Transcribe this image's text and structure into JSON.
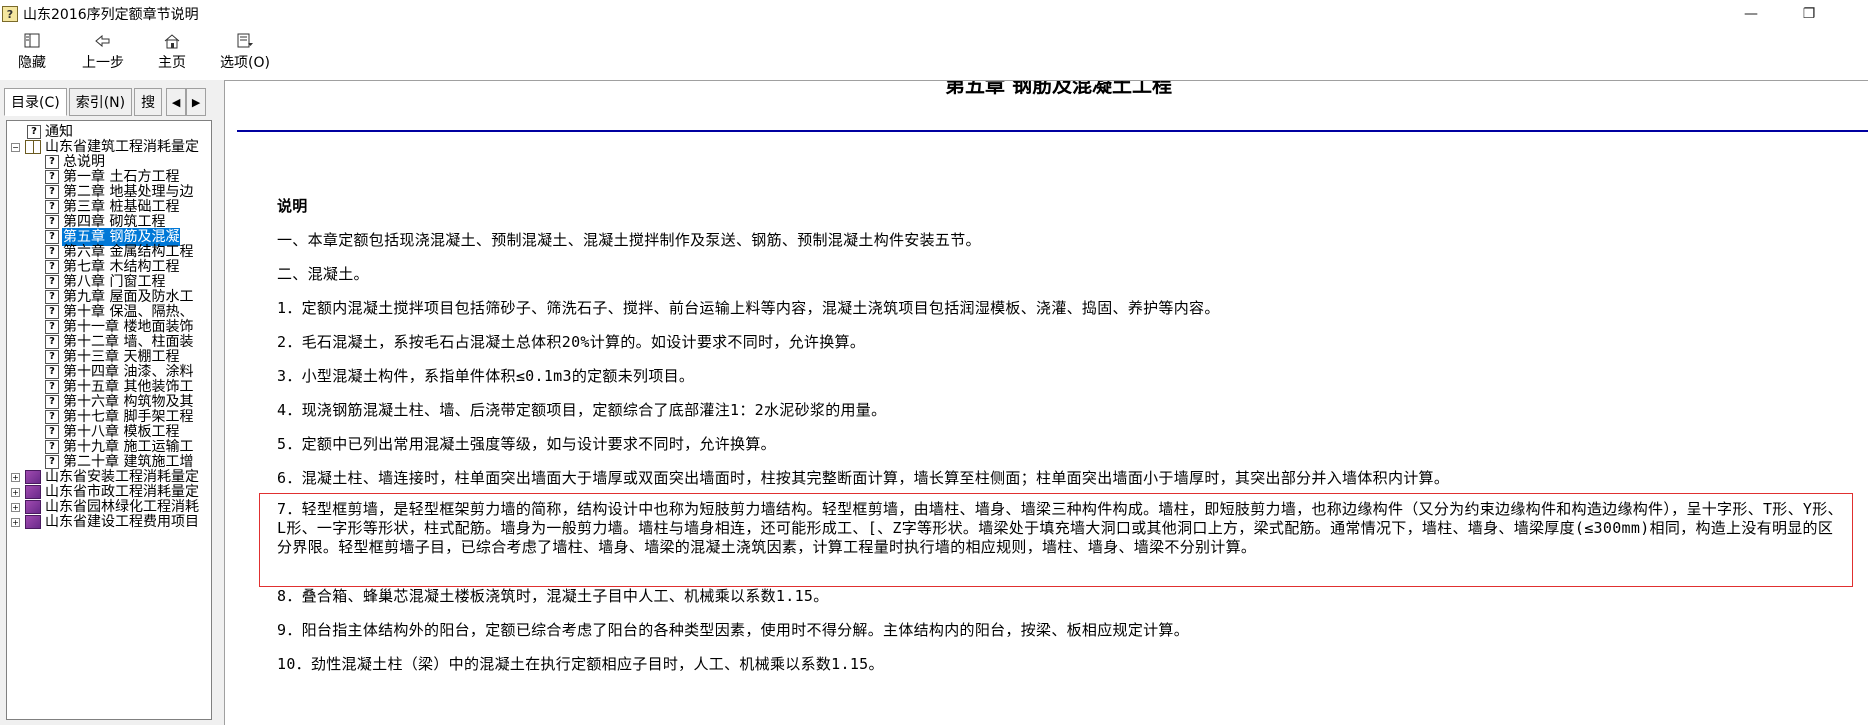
{
  "window": {
    "title": "山东2016序列定额章节说明",
    "icon_label": "?",
    "minimize_glyph": "—",
    "restore_glyph": "❐"
  },
  "toolbar": [
    {
      "label": "隐藏",
      "icon": "hide-icon"
    },
    {
      "label": "上一步",
      "icon": "back-arrow-icon"
    },
    {
      "label": "主页",
      "icon": "home-icon"
    },
    {
      "label": "选项(O)",
      "icon": "options-icon"
    }
  ],
  "tabs": {
    "contents": "目录(C)",
    "index": "索引(N)",
    "search": "搜",
    "left_arrow": "◀",
    "right_arrow": "▶"
  },
  "tree": [
    {
      "level": 1,
      "type": "help",
      "label": "通知"
    },
    {
      "level": 0,
      "type": "book-open",
      "expander": "−",
      "label": "山东省建筑工程消耗量定"
    },
    {
      "level": 2,
      "type": "help",
      "label": "总说明"
    },
    {
      "level": 2,
      "type": "help",
      "label": "第一章 土石方工程"
    },
    {
      "level": 2,
      "type": "help",
      "label": "第二章 地基处理与边"
    },
    {
      "level": 2,
      "type": "help",
      "label": "第三章 桩基础工程"
    },
    {
      "level": 2,
      "type": "help",
      "label": "第四章 砌筑工程"
    },
    {
      "level": 2,
      "type": "help",
      "label": "第五章 钢筋及混凝",
      "selected": true
    },
    {
      "level": 2,
      "type": "help",
      "label": "第六章 金属结构工程"
    },
    {
      "level": 2,
      "type": "help",
      "label": "第七章 木结构工程"
    },
    {
      "level": 2,
      "type": "help",
      "label": "第八章 门窗工程"
    },
    {
      "level": 2,
      "type": "help",
      "label": "第九章 屋面及防水工"
    },
    {
      "level": 2,
      "type": "help",
      "label": "第十章 保温、隔热、"
    },
    {
      "level": 2,
      "type": "help",
      "label": "第十一章 楼地面装饰"
    },
    {
      "level": 2,
      "type": "help",
      "label": "第十二章 墙、柱面装"
    },
    {
      "level": 2,
      "type": "help",
      "label": "第十三章 天棚工程"
    },
    {
      "level": 2,
      "type": "help",
      "label": "第十四章 油漆、涂料"
    },
    {
      "level": 2,
      "type": "help",
      "label": "第十五章 其他装饰工"
    },
    {
      "level": 2,
      "type": "help",
      "label": "第十六章 构筑物及其"
    },
    {
      "level": 2,
      "type": "help",
      "label": "第十七章 脚手架工程"
    },
    {
      "level": 2,
      "type": "help",
      "label": "第十八章 模板工程"
    },
    {
      "level": 2,
      "type": "help",
      "label": "第十九章 施工运输工"
    },
    {
      "level": 2,
      "type": "help",
      "label": "第二十章 建筑施工增"
    },
    {
      "level": 0,
      "type": "book",
      "expander": "+",
      "label": "山东省安装工程消耗量定"
    },
    {
      "level": 0,
      "type": "book",
      "expander": "+",
      "label": "山东省市政工程消耗量定"
    },
    {
      "level": 0,
      "type": "book",
      "expander": "+",
      "label": "山东省园林绿化工程消耗"
    },
    {
      "level": 0,
      "type": "book",
      "expander": "+",
      "label": "山东省建设工程费用项目"
    }
  ],
  "content": {
    "chapter_title": "第五章 钢筋及混凝土工程",
    "heading": "说明",
    "paragraphs": [
      "一、本章定额包括现浇混凝土、预制混凝土、混凝土搅拌制作及泵送、钢筋、预制混凝土构件安装五节。",
      "二、混凝土。",
      "1．定额内混凝土搅拌项目包括筛砂子、筛洗石子、搅拌、前台运输上料等内容，混凝土浇筑项目包括润湿模板、浇灌、捣固、养护等内容。",
      "2．毛石混凝土，系按毛石占混凝土总体积20%计算的。如设计要求不同时，允许换算。",
      "3．小型混凝土构件，系指单件体积≤0.1m3的定额未列项目。",
      "4．现浇钢筋混凝土柱、墙、后浇带定额项目，定额综合了底部灌注1：2水泥砂浆的用量。",
      "5．定额中已列出常用混凝土强度等级，如与设计要求不同时，允许换算。",
      "6．混凝土柱、墙连接时，柱单面突出墙面大于墙厚或双面突出墙面时，柱按其完整断面计算，墙长算至柱侧面；柱单面突出墙面小于墙厚时，其突出部分并入墙体积内计算。",
      "7．轻型框剪墙，是轻型框架剪力墙的简称，结构设计中也称为短肢剪力墙结构。轻型框剪墙，由墙柱、墙身、墙梁三种构件构成。墙柱，即短肢剪力墙，也称边缘构件（又分为约束边缘构件和构造边缘构件），呈十字形、T形、Y形、L形、一字形等形状，柱式配筋。墙身为一般剪力墙。墙柱与墙身相连，还可能形成工、[、Z字等形状。墙梁处于填充墙大洞口或其他洞口上方，梁式配筋。通常情况下，墙柱、墙身、墙梁厚度(≤300mm)相同，构造上没有明显的区分界限。轻型框剪墙子目，已综合考虑了墙柱、墙身、墙梁的混凝土浇筑因素，计算工程量时执行墙的相应规则，墙柱、墙身、墙梁不分别计算。",
      "8．叠合箱、蜂巢芯混凝土楼板浇筑时，混凝土子目中人工、机械乘以系数1.15。",
      "9．阳台指主体结构外的阳台，定额已综合考虑了阳台的各种类型因素，使用时不得分解。主体结构内的阳台，按梁、板相应规定计算。",
      "10．劲性混凝土柱（梁）中的混凝土在执行定额相应子目时，人工、机械乘以系数1.15。"
    ]
  }
}
